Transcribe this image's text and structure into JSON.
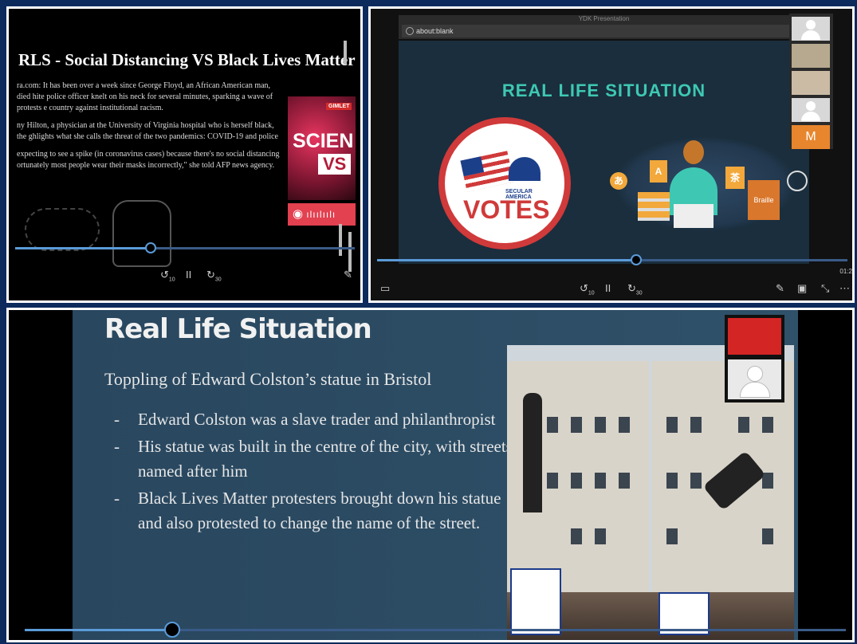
{
  "panel1": {
    "title": "RLS - Social Distancing VS Black Lives Matter",
    "para1": "ra.com: It has been over a week since George Floyd, an African American man, died hite police officer knelt on his neck for several minutes, sparking a wave of protests e country against institutional racism.",
    "para2": "ny Hilton, a physician at the University of Virginia hospital who is herself black, the ghlights what she calls the threat of the two pandemics: COVID-19 and police",
    "para3": "expecting to see a spike (in coronavirus cases) because there's no social distancing ortunately most people wear their masks incorrectly,\" she told AFP news agency.",
    "badge_tag": "GIMLET",
    "badge_word": "SCIEN",
    "badge_vs": "VS",
    "spotify_icon": "spotify-icon",
    "progress": 0.4,
    "skip_back": "10",
    "skip_fwd": "30",
    "pause": "II"
  },
  "panel2": {
    "window_title": "YDK Presentation",
    "address": "about:blank",
    "slide_title": "REAL LIFE SITUATION",
    "votes_secular": "SECULAR AMERICA",
    "votes_word": "VOTES",
    "braille": "Braille",
    "icon_a": "A",
    "icon_tea": "茶",
    "icon_glyph": "あ",
    "sidebar_m": "M",
    "time": "01:2",
    "progress": 0.55,
    "skip_back": "10",
    "skip_fwd": "30",
    "pause": "II"
  },
  "panel3": {
    "title": "Real Life Situation",
    "subtitle": "Toppling of Edward Colston’s statue in Bristol",
    "bullets": [
      "Edward Colston was a slave trader and philanthropist",
      "His statue was built in the centre of the city, with streets named after him",
      "Black Lives Matter protesters brought down his statue and also protested to change the name of the street."
    ],
    "dash": "-",
    "progress": 0.18
  },
  "colors": {
    "accent_teal": "#3ec8b3",
    "progress_blue": "#5b9bd8",
    "votes_red": "#d03a3a",
    "slide3_bg": "#2f5169"
  }
}
